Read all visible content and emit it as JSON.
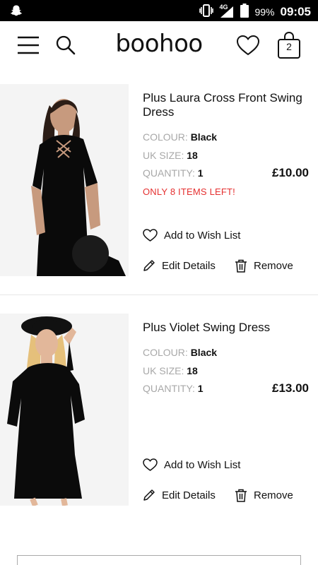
{
  "status_bar": {
    "network": "4G",
    "battery": "99%",
    "time": "09:05"
  },
  "header": {
    "logo": "boohoo",
    "bag_count": "2"
  },
  "items": [
    {
      "name": "Plus Laura Cross Front Swing Dress",
      "colour_label": "COLOUR:",
      "colour_value": "Black",
      "size_label": "UK SIZE:",
      "size_value": "18",
      "quantity_label": "QUANTITY:",
      "quantity_value": "1",
      "price": "£10.00",
      "stock_warning": "ONLY 8 ITEMS LEFT!",
      "wishlist_label": "Add to Wish List",
      "edit_label": "Edit Details",
      "remove_label": "Remove"
    },
    {
      "name": "Plus Violet Swing Dress",
      "colour_label": "COLOUR:",
      "colour_value": "Black",
      "size_label": "UK SIZE:",
      "size_value": "18",
      "quantity_label": "QUANTITY:",
      "quantity_value": "1",
      "price": "£13.00",
      "wishlist_label": "Add to Wish List",
      "edit_label": "Edit Details",
      "remove_label": "Remove"
    }
  ],
  "colors": {
    "status_bar": "#000000",
    "stock_warning": "#e53030",
    "muted_label": "#a8a8a8"
  },
  "icons": [
    "snapchat-icon",
    "vibrate-icon",
    "signal-icon",
    "battery-icon",
    "menu-icon",
    "search-icon",
    "heart-icon",
    "bag-icon",
    "pencil-icon",
    "trash-icon"
  ]
}
